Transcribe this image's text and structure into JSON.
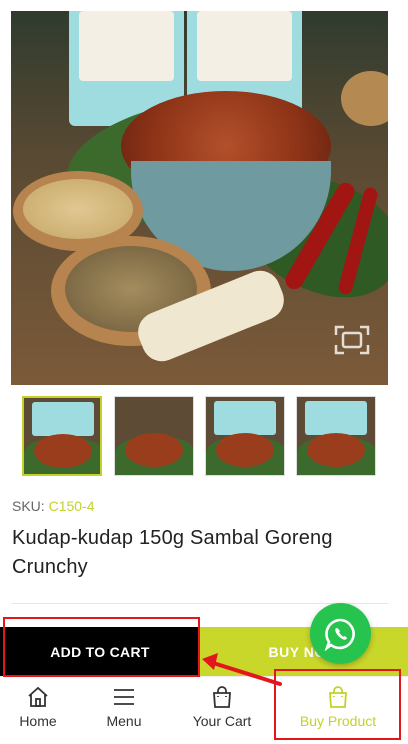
{
  "product": {
    "sku_label": "SKU:",
    "sku_value": "C150-4",
    "title": "Kudap-kudap 150g Sambal Goreng Crunchy",
    "thumbnail_count": 4
  },
  "actions": {
    "add_to_cart_label": "ADD TO CART",
    "buy_now_label": "BUY NOW"
  },
  "bottom_nav": {
    "items": [
      {
        "label": "Home",
        "icon": "home-icon"
      },
      {
        "label": "Menu",
        "icon": "menu-icon"
      },
      {
        "label": "Your Cart",
        "icon": "bag-icon"
      },
      {
        "label": "Buy Product",
        "icon": "bag-icon",
        "active": true
      }
    ]
  },
  "colors": {
    "accent": "#c9d62a",
    "add_to_cart_bg": "#000000",
    "whatsapp": "#26c34f",
    "annotation": "#e3161b"
  }
}
